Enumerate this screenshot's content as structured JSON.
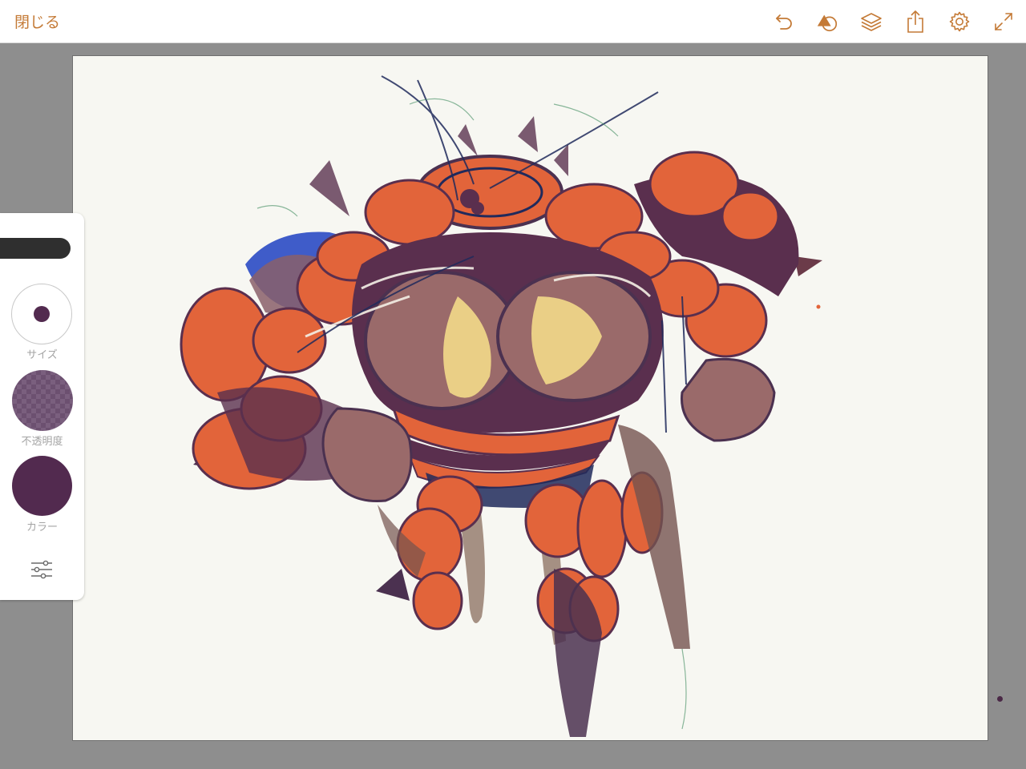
{
  "topbar": {
    "close_label": "閉じる",
    "accent_color": "#c47a36"
  },
  "toolbar": {
    "icons": [
      "undo-icon",
      "shapes-icon",
      "layers-icon",
      "share-icon",
      "settings-icon",
      "fullscreen-icon"
    ]
  },
  "brush_panel": {
    "size_label": "サイズ",
    "opacity_label": "不透明度",
    "color_label": "カラー",
    "current_color": "#522a4f",
    "settings_icon": "sliders-icon"
  },
  "canvas": {
    "background": "#f7f7f2",
    "palette": [
      "#e2643a",
      "#5a2f4e",
      "#9a6a6a",
      "#eacf86",
      "#3f5cc9",
      "#202a5c",
      "#74534f"
    ]
  }
}
